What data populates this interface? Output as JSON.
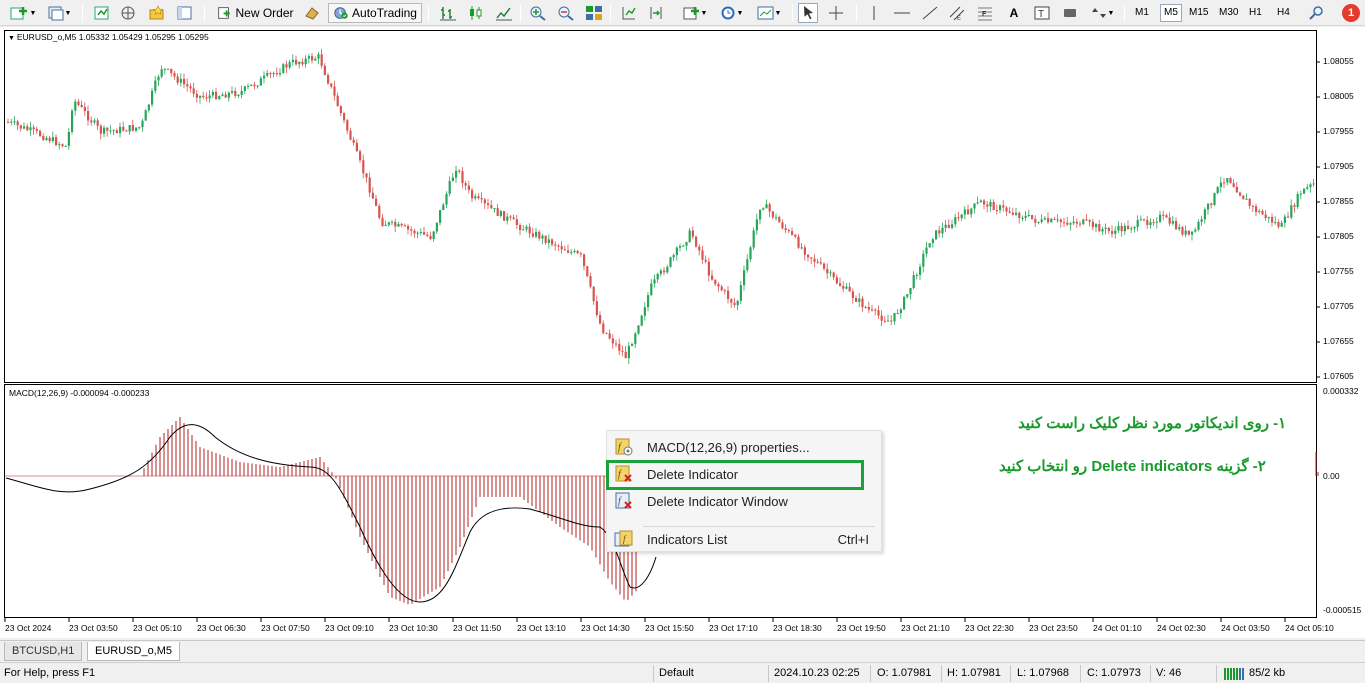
{
  "toolbar": {
    "new_order_label": "New Order",
    "autotrading_label": "AutoTrading",
    "timeframes": [
      "M1",
      "M5",
      "M15",
      "M30",
      "H1",
      "H4"
    ],
    "active_timeframe": "M5",
    "notification_count": "1"
  },
  "chart": {
    "symbol_header": "EURUSD_o,M5  1.05332 1.05429 1.05295 1.05295",
    "price_ticks": [
      "1.08055",
      "1.08005",
      "1.07955",
      "1.07905",
      "1.07855",
      "1.07805",
      "1.07755",
      "1.07705",
      "1.07655",
      "1.07605"
    ],
    "macd_header": "MACD(12,26,9) -0.000094 -0.000233",
    "macd_ticks": [
      "0.000332",
      "0.00",
      "-0.000515"
    ],
    "time_ticks": [
      "23 Oct 2024",
      "23 Oct 03:50",
      "23 Oct 05:10",
      "23 Oct 06:30",
      "23 Oct 07:50",
      "23 Oct 09:10",
      "23 Oct 10:30",
      "23 Oct 11:50",
      "23 Oct 13:10",
      "23 Oct 14:30",
      "23 Oct 15:50",
      "23 Oct 17:10",
      "23 Oct 18:30",
      "23 Oct 19:50",
      "23 Oct 21:10",
      "23 Oct 22:30",
      "23 Oct 23:50",
      "24 Oct 01:10",
      "24 Oct 02:30",
      "24 Oct 03:50",
      "24 Oct 05:10"
    ],
    "colors": {
      "bull": "#26a65b",
      "bear": "#d9534f",
      "histogram": "#b22222",
      "signal": "#000000"
    }
  },
  "context_menu": {
    "items": [
      {
        "label": "MACD(12,26,9) properties...",
        "shortcut": "",
        "icon": "properties-icon"
      },
      {
        "label": "Delete Indicator",
        "shortcut": "",
        "icon": "delete-indicator-icon"
      },
      {
        "label": "Delete Indicator Window",
        "shortcut": "",
        "icon": "delete-window-icon"
      },
      {
        "label": "Indicators List",
        "shortcut": "Ctrl+I",
        "icon": "indicators-list-icon"
      }
    ],
    "highlighted_item": "Delete Indicator"
  },
  "annotations": {
    "step1": "۱- روی اندیکاتور مورد نظر کلیک راست کنید",
    "step2": "۲- گزینه   Delete indicators    رو انتخاب کنید"
  },
  "tabs": [
    "BTCUSD,H1",
    "EURUSD_o,M5"
  ],
  "active_tab": "EURUSD_o,M5",
  "status_bar": {
    "help": "For Help, press F1",
    "profile": "Default",
    "datetime": "2024.10.23 02:25",
    "open": "O: 1.07981",
    "high": "H: 1.07981",
    "low": "L: 1.07968",
    "close": "C: 1.07973",
    "volume": "V: 46",
    "traffic": "85/2 kb"
  }
}
